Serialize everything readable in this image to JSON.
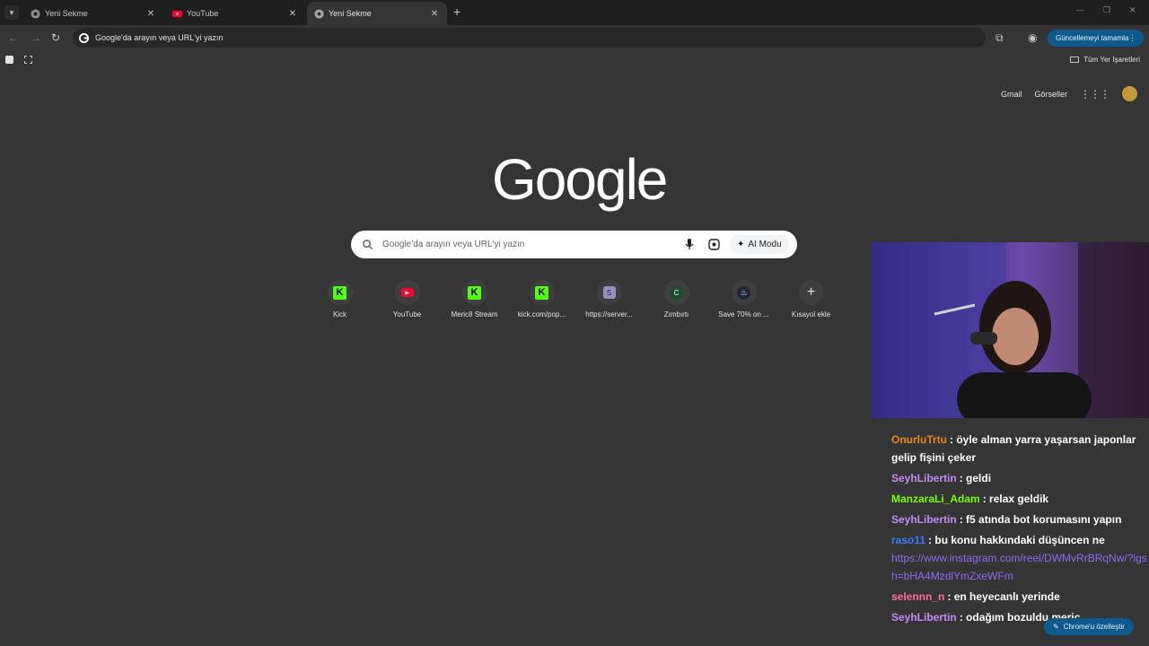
{
  "tabs": [
    {
      "title": "Yeni Sekme",
      "active": false
    },
    {
      "title": "YouTube",
      "active": false
    },
    {
      "title": "Yeni Sekme",
      "active": true
    }
  ],
  "omnibox": {
    "placeholder": "Google'da arayın veya URL'yi yazın"
  },
  "update_button": "Güncellemeyi tamamla",
  "bookmarks": {
    "all_bookmarks": "Tüm Yer İşaretleri"
  },
  "ntp": {
    "gmail": "Gmail",
    "images": "Görseller",
    "logo": "Google",
    "search_placeholder": "Google'da arayın veya URL'yi yazın",
    "ai_mode": "AI Modu",
    "shortcuts": [
      {
        "label": "Kick",
        "icon": "kick-icon",
        "glyph": "K"
      },
      {
        "label": "YouTube",
        "icon": "youtube-icon",
        "glyph": "▶"
      },
      {
        "label": "Meric8 Stream",
        "icon": "kick-icon",
        "glyph": "K"
      },
      {
        "label": "kick.com/pop...",
        "icon": "kick-icon",
        "glyph": "K"
      },
      {
        "label": "https://server...",
        "icon": "server-icon",
        "glyph": "S"
      },
      {
        "label": "Zımbırtı",
        "icon": "letter-c-icon",
        "glyph": "C"
      },
      {
        "label": "Save 70% on ...",
        "icon": "steam-icon",
        "glyph": "♨"
      },
      {
        "label": "Kısayol ekle",
        "icon": "plus-icon",
        "glyph": "+"
      }
    ],
    "customize": "Chrome'u özelleştir"
  },
  "chat": [
    {
      "user": "OnurluTrtu",
      "color": "#e38a26",
      "text": "öyle alman yarra yaşarsan japonlar gelip fişini çeker"
    },
    {
      "user": "SeyhLibertin",
      "color": "#c58af9",
      "text": "geldi"
    },
    {
      "user": "ManzaraLi_Adam",
      "color": "#7cfc00",
      "text": "relax geldik"
    },
    {
      "user": "SeyhLibertin",
      "color": "#c58af9",
      "text": "f5 atında bot korumasını yapın"
    },
    {
      "user": "raso11",
      "color": "#3d7cf5",
      "text": "bu konu hakkındaki düşüncen ne",
      "link": "https://www.instagram.com/reel/DWMvRrBRqNw/?igsh=bHA4MzdlYmZxeWFm"
    },
    {
      "user": "selennn_n",
      "color": "#ff6b9d",
      "text": "en heyecanlı yerinde"
    },
    {
      "user": "SeyhLibertin",
      "color": "#c58af9",
      "text": "odağım bozuldu meriç"
    }
  ]
}
